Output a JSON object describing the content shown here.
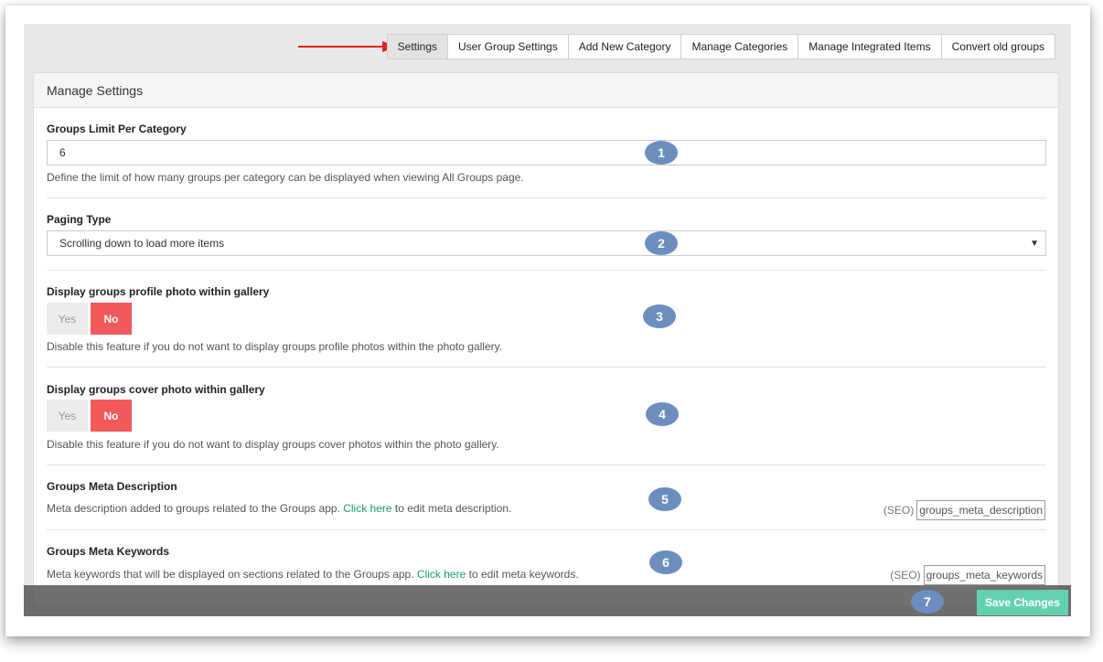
{
  "tabs": [
    {
      "label": "Settings",
      "active": true
    },
    {
      "label": "User Group Settings"
    },
    {
      "label": "Add New Category"
    },
    {
      "label": "Manage Categories"
    },
    {
      "label": "Manage Integrated Items"
    },
    {
      "label": "Convert old groups"
    }
  ],
  "panel": {
    "title": "Manage Settings"
  },
  "groups_limit": {
    "label": "Groups Limit Per Category",
    "value": "6",
    "help": "Define the limit of how many groups per category can be displayed when viewing All Groups page."
  },
  "paging_type": {
    "label": "Paging Type",
    "selected": "Scrolling down to load more items"
  },
  "profile_photo": {
    "label": "Display groups profile photo within gallery",
    "yes": "Yes",
    "no": "No",
    "help": "Disable this feature if you do not want to display groups profile photos within the photo gallery."
  },
  "cover_photo": {
    "label": "Display groups cover photo within gallery",
    "yes": "Yes",
    "no": "No",
    "help": "Disable this feature if you do not want to display groups cover photos within the photo gallery."
  },
  "meta_description": {
    "label": "Groups Meta Description",
    "help_before": "Meta description added to groups related to the Groups app.",
    "link": "Click here",
    "help_after": "to edit meta description.",
    "seo_label": "(SEO)",
    "seo_value": "groups_meta_description"
  },
  "meta_keywords": {
    "label": "Groups Meta Keywords",
    "help_before": "Meta keywords that will be displayed on sections related to the Groups app.",
    "link": "Click here",
    "help_after": "to edit meta keywords.",
    "seo_label": "(SEO)",
    "seo_value": "groups_meta_keywords"
  },
  "footer": {
    "save_label": "Save Changes"
  },
  "badges": [
    "1",
    "2",
    "3",
    "4",
    "5",
    "6",
    "7"
  ],
  "colors": {
    "arrow": "#e0201e",
    "badge": "#6b8ebf",
    "no_active": "#f1595a",
    "save": "#64d0b2",
    "link": "#1a9b74"
  }
}
